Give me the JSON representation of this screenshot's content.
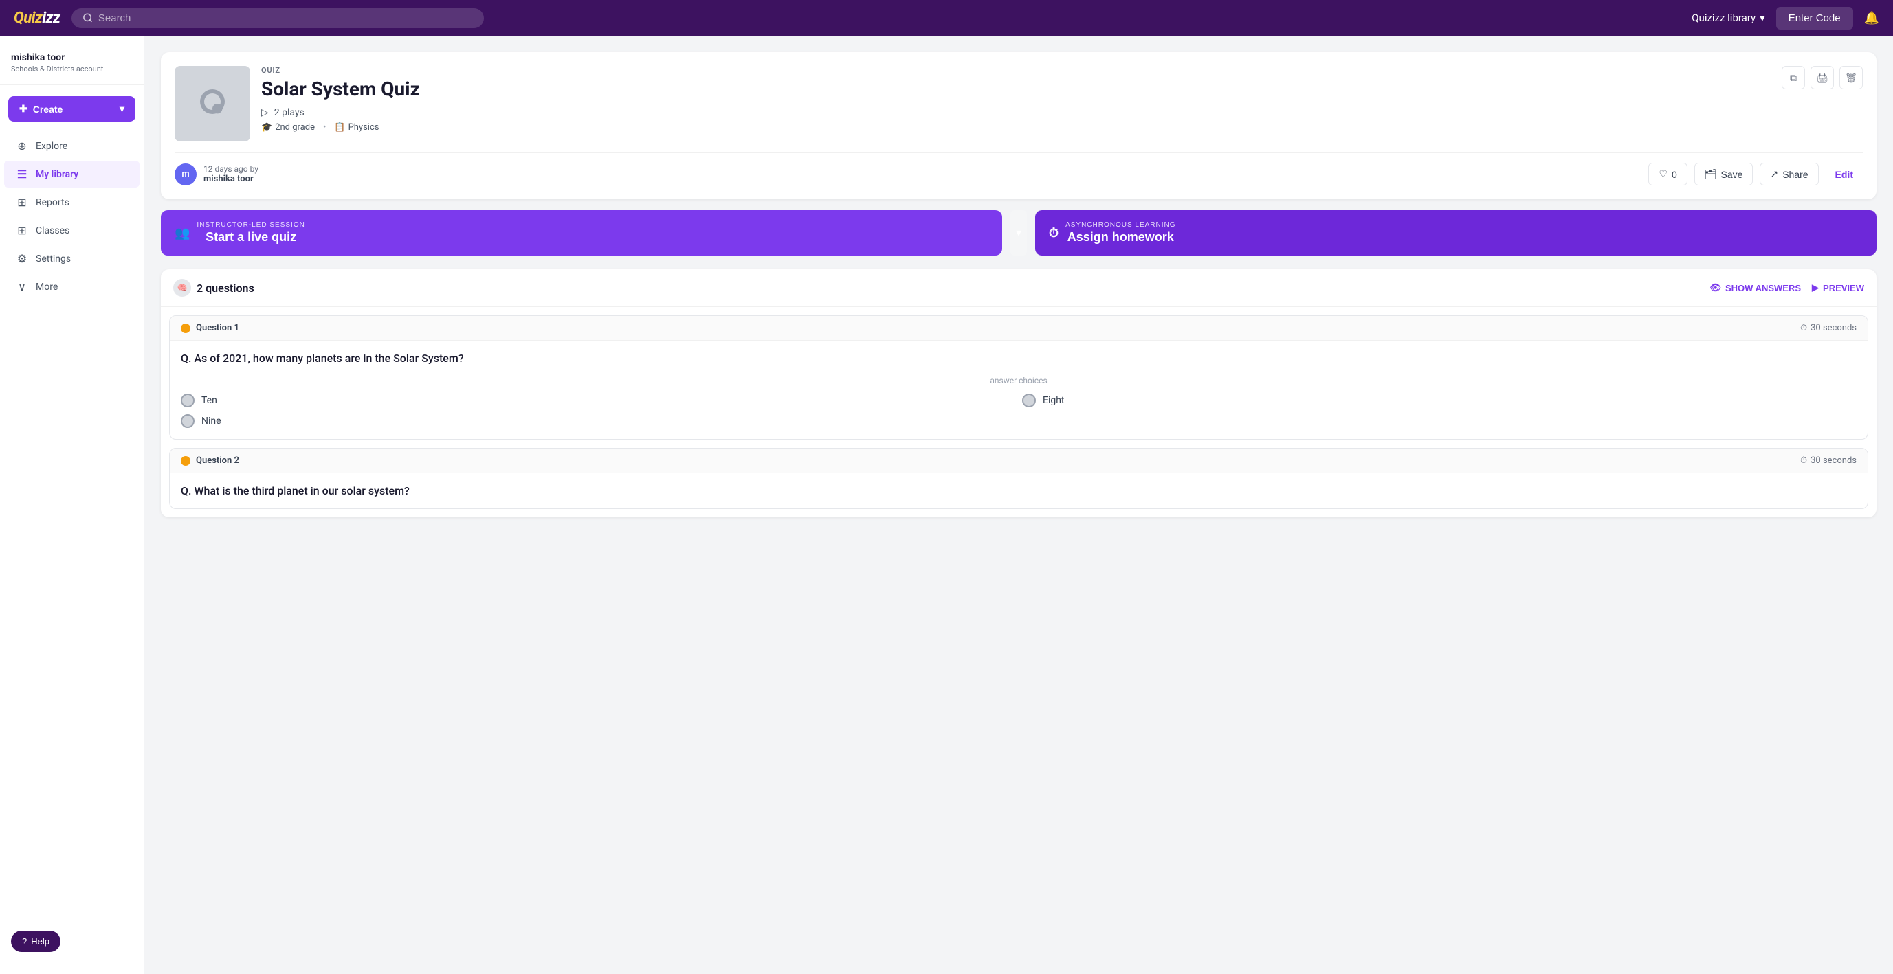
{
  "topNav": {
    "logo": "Quizizz",
    "searchPlaceholder": "Search",
    "libraryLabel": "Quizizz library",
    "enterCodeLabel": "Enter Code"
  },
  "sidebar": {
    "userName": "mishika toor",
    "userSubtitle": "Schools & Districts account",
    "createLabel": "Create",
    "navItems": [
      {
        "id": "explore",
        "label": "Explore",
        "icon": "⊕"
      },
      {
        "id": "my-library",
        "label": "My library",
        "icon": "☰",
        "active": true
      },
      {
        "id": "reports",
        "label": "Reports",
        "icon": "⊞"
      },
      {
        "id": "classes",
        "label": "Classes",
        "icon": "⊞"
      },
      {
        "id": "settings",
        "label": "Settings",
        "icon": "⚙"
      },
      {
        "id": "more",
        "label": "More",
        "icon": "∨"
      }
    ],
    "helpLabel": "Help"
  },
  "quiz": {
    "typeLabel": "QUIZ",
    "title": "Solar System Quiz",
    "plays": "2 plays",
    "grade": "2nd grade",
    "subject": "Physics",
    "authorInitial": "m",
    "authorName": "mishika toor",
    "authorTime": "12 days ago by",
    "likeCount": "0",
    "saveBtnLabel": "Save",
    "shareBtnLabel": "Share",
    "editBtnLabel": "Edit"
  },
  "actionButtons": {
    "liveQuizSublabel": "INSTRUCTOR-LED SESSION",
    "liveQuizLabel": "Start a live quiz",
    "homeworkSublabel": "ASYNCHRONOUS LEARNING",
    "homeworkLabel": "Assign homework"
  },
  "questionsSection": {
    "questionsCount": "2 questions",
    "showAnswersLabel": "SHOW ANSWERS",
    "previewLabel": "PREVIEW",
    "questions": [
      {
        "id": 1,
        "label": "Question 1",
        "timer": "30 seconds",
        "text": "Q. As of 2021, how many planets are in the Solar System?",
        "answerChoicesLabel": "answer choices",
        "choices": [
          {
            "text": "Ten"
          },
          {
            "text": "Eight"
          },
          {
            "text": "Nine"
          }
        ]
      },
      {
        "id": 2,
        "label": "Question 2",
        "timer": "30 seconds",
        "text": "Q. What is the third planet in our solar system?"
      }
    ]
  }
}
